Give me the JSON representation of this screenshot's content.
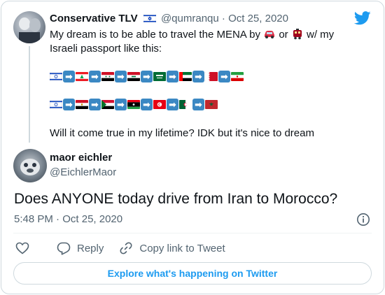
{
  "quoted_tweet": {
    "author_name": "Conservative TLV",
    "author_flag_icon": "israel-flag-emoji",
    "handle": "@qumranqu",
    "separator": "·",
    "date": "Oct 25, 2020",
    "text_part1": "My dream is to be able to travel the MENA by",
    "text_or": "or",
    "text_part2": "w/ my Israeli passport like this:",
    "flag_row_1": [
      "israel",
      "lebanon",
      "syria",
      "iraq",
      "saudi-arabia",
      "uae",
      "bahrain",
      "iran"
    ],
    "flag_row_2": [
      "israel",
      "egypt",
      "sudan",
      "libya",
      "tunisia",
      "algeria",
      "morocco"
    ],
    "footer": "Will it come true in my lifetime? IDK but it's nice to dream"
  },
  "tweet": {
    "author_name": "maor eichler",
    "handle": "@EichlerMaor",
    "text": "Does ANYONE today drive from Iran to Morocco?",
    "time": "5:48 PM",
    "separator": "·",
    "date": "Oct 25, 2020"
  },
  "actions": {
    "reply_label": "Reply",
    "copy_link_label": "Copy link to Tweet"
  },
  "explore_button": "Explore what's happening on Twitter",
  "colors": {
    "twitter_blue": "#1d9bf0",
    "text_primary": "#0f1419",
    "text_secondary": "#536471",
    "border": "#cfd9de",
    "arrow_emoji_blue": "#3b88c3"
  }
}
